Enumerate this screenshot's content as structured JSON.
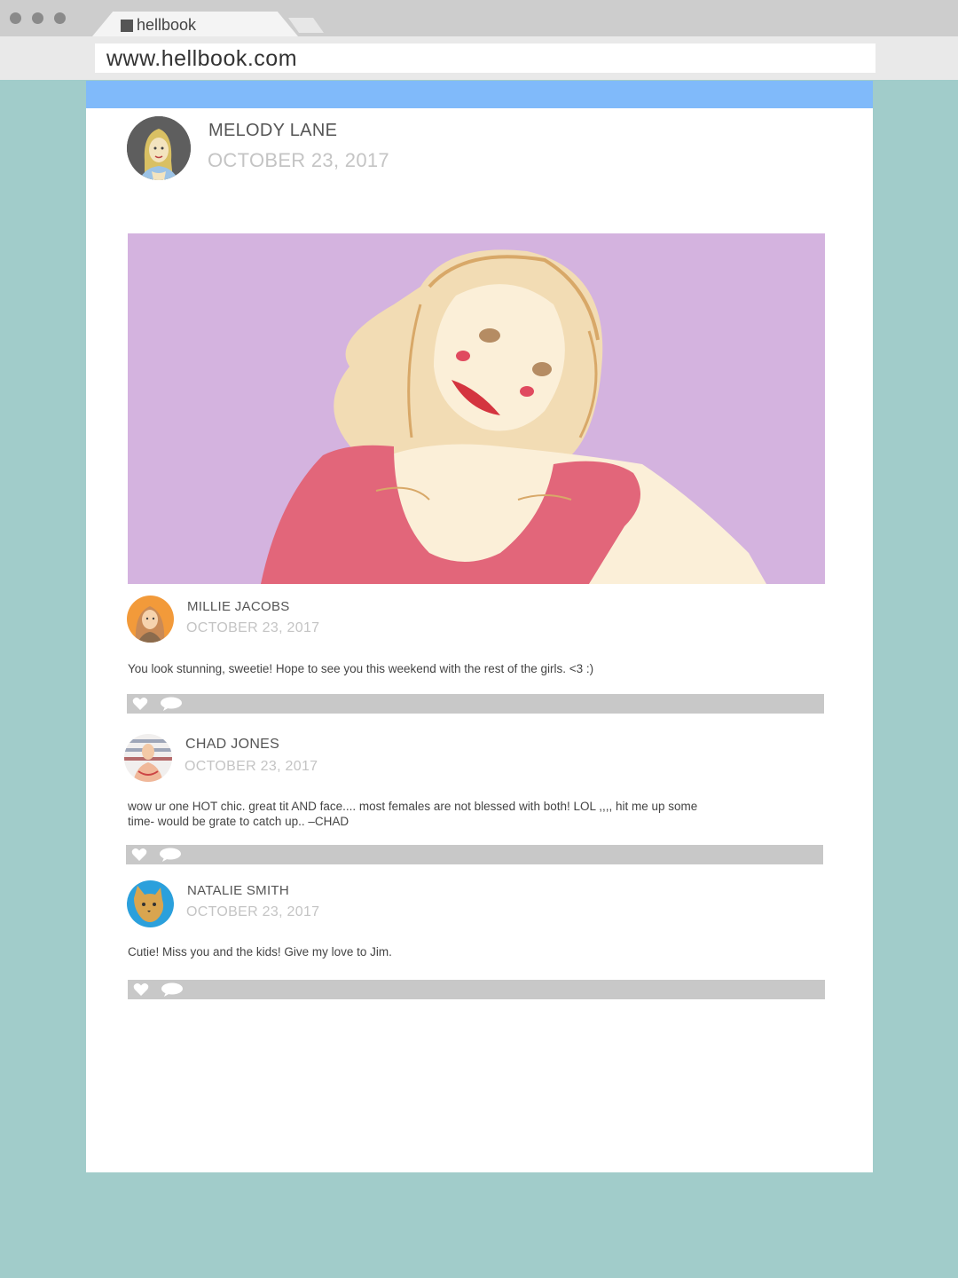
{
  "browser": {
    "tab_title": "hellbook",
    "url": "www.hellbook.com"
  },
  "post": {
    "author": "MELODY LANE",
    "date": "OCTOBER 23, 2017",
    "image_icon": "post-photo"
  },
  "comments": [
    {
      "author": "MILLIE JACOBS",
      "date": "OCTOBER 23, 2017",
      "text": "You look stunning, sweetie! Hope to see you this weekend with the rest of the girls. <3 :)"
    },
    {
      "author": "CHAD JONES",
      "date": "OCTOBER 23, 2017",
      "text_line1": "wow ur one HOT chic. great tit AND face.... most females are not blessed with both! LOL ,,,, hit me up some",
      "text_line2": "time- would be grate to catch up..  –CHAD"
    },
    {
      "author": "NATALIE SMITH",
      "date": "OCTOBER 23, 2017",
      "text": "Cutie! Miss you and the kids! Give my love to Jim."
    }
  ],
  "colors": {
    "page_bg": "#a1ccca",
    "header_bar": "#80bafa",
    "action_bar": "#c8c8c8",
    "photo_bg": "#d4b3df",
    "shirt": "#e2667a"
  }
}
